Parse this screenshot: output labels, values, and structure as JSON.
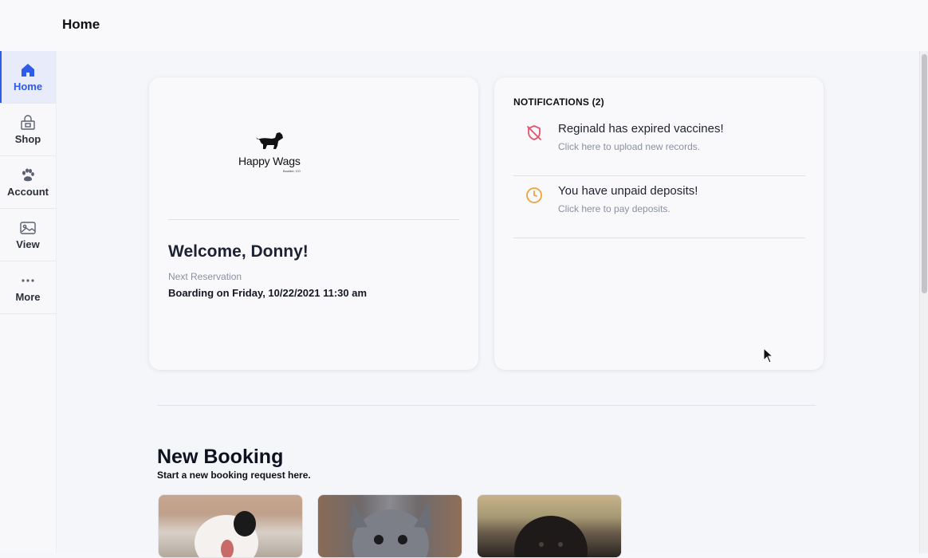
{
  "page": {
    "title": "Home"
  },
  "sidebar": {
    "items": [
      {
        "label": "Home",
        "icon": "home-icon",
        "active": true
      },
      {
        "label": "Shop",
        "icon": "shop-icon",
        "active": false
      },
      {
        "label": "Account",
        "icon": "paw-icon",
        "active": false
      },
      {
        "label": "View",
        "icon": "image-icon",
        "active": false
      },
      {
        "label": "More",
        "icon": "more-icon",
        "active": false
      }
    ]
  },
  "welcome": {
    "logo": {
      "brand": "Happy Wags",
      "location": "Boulder, CO"
    },
    "title": "Welcome, Donny!",
    "next_label": "Next Reservation",
    "next_value": "Boarding on Friday, 10/22/2021 11:30 am"
  },
  "notifications": {
    "header": "NOTIFICATIONS (2)",
    "items": [
      {
        "title": "Reginald has expired vaccines!",
        "subtitle": "Click here to upload new records.",
        "icon": "shield-off-icon",
        "color": "#e2556f"
      },
      {
        "title": "You have unpaid deposits!",
        "subtitle": "Click here to pay deposits.",
        "icon": "clock-icon",
        "color": "#f0a23a"
      }
    ]
  },
  "new_booking": {
    "title": "New Booking",
    "subtitle": "Start a new booking request here.",
    "options": [
      {
        "image": "puppy-photo"
      },
      {
        "image": "french-bulldog-photo"
      },
      {
        "image": "black-puppy-photo"
      }
    ]
  },
  "colors": {
    "accent": "#2f5bea",
    "alert": "#e2556f",
    "warning": "#f0a23a"
  }
}
